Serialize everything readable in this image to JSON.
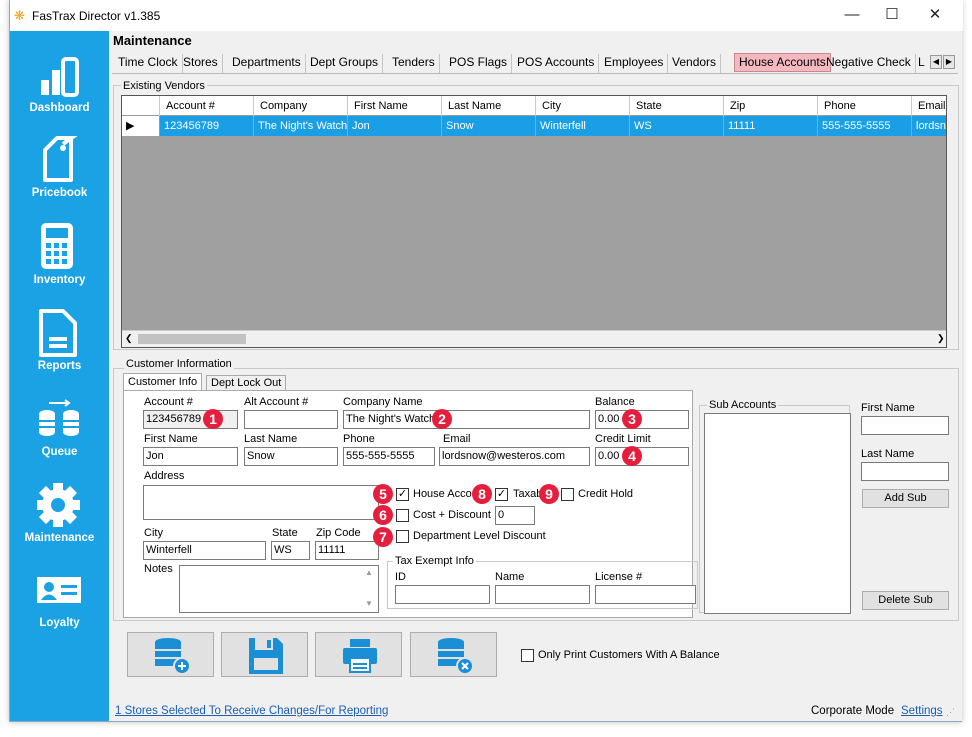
{
  "window": {
    "title": "FasTrax Director v1.385",
    "minimize": "—",
    "maximize": "☐",
    "close": "✕"
  },
  "sidebar": {
    "items": [
      {
        "id": "dashboard",
        "label": "Dashboard",
        "icon": "bar-chart-icon"
      },
      {
        "id": "pricebook",
        "label": "Pricebook",
        "icon": "tag-icon"
      },
      {
        "id": "inventory",
        "label": "Inventory",
        "icon": "calculator-icon"
      },
      {
        "id": "reports",
        "label": "Reports",
        "icon": "document-icon"
      },
      {
        "id": "queue",
        "label": "Queue",
        "icon": "database-sync-icon"
      },
      {
        "id": "maintenance",
        "label": "Maintenance",
        "icon": "gear-icon"
      },
      {
        "id": "loyalty",
        "label": "Loyalty",
        "icon": "id-card-icon"
      }
    ]
  },
  "header": {
    "title": "Maintenance"
  },
  "tabs": [
    "Time Clock",
    "Stores",
    "Departments",
    "Dept Groups",
    "Tenders",
    "POS Flags",
    "POS Accounts",
    "Employees",
    "Vendors",
    "House Accounts",
    "Negative Check",
    "L"
  ],
  "active_tab": "House Accounts",
  "existing": {
    "label": "Existing Vendors",
    "columns": [
      "Account #",
      "Company",
      "First Name",
      "Last Name",
      "City",
      "State",
      "Zip",
      "Phone",
      "Email"
    ],
    "rows": [
      {
        "indicator": "▶",
        "cells": [
          "123456789",
          "The Night's Watch",
          "Jon",
          "Snow",
          "Winterfell",
          "WS",
          "11111",
          "555-555-5555",
          "lordsnow"
        ]
      }
    ]
  },
  "customer": {
    "group_label": "Customer Information",
    "tabs": [
      "Customer Info",
      "Dept Lock Out"
    ],
    "fields": {
      "account_label": "Account #",
      "account": "123456789",
      "alt_label": "Alt Account #",
      "alt": "",
      "company_label": "Company Name",
      "company": "The Night's Watch",
      "balance_label": "Balance",
      "balance": "0.00",
      "first_label": "First Name",
      "first": "Jon",
      "last_label": "Last Name",
      "last": "Snow",
      "phone_label": "Phone",
      "phone": "555-555-5555",
      "email_label": "Email",
      "email": "lordsnow@westeros.com",
      "credit_label": "Credit Limit",
      "credit": "0.00",
      "address_label": "Address",
      "address": "",
      "city_label": "City",
      "city": "Winterfell",
      "state_label": "State",
      "state": "WS",
      "zip_label": "Zip Code",
      "zip": "11111",
      "notes_label": "Notes",
      "notes": ""
    },
    "checkboxes": {
      "house_account": "House Account",
      "taxable": "Taxable",
      "credit_hold": "Credit Hold",
      "cost_discount": "Cost + Discount",
      "cost_discount_value": "0",
      "dept_level_discount": "Department Level Discount"
    },
    "checked": {
      "house_account": true,
      "taxable": true,
      "credit_hold": false,
      "cost_discount": false,
      "dept_level_discount": false
    },
    "tax_exempt": {
      "label": "Tax Exempt Info",
      "id_label": "ID",
      "name_label": "Name",
      "license_label": "License #"
    },
    "sub_accounts": {
      "label": "Sub Accounts",
      "first_label": "First Name",
      "last_label": "Last Name",
      "add": "Add Sub",
      "delete": "Delete Sub"
    },
    "badges": [
      "1",
      "2",
      "3",
      "4",
      "5",
      "6",
      "7",
      "8",
      "9"
    ]
  },
  "actions": {
    "add_icon": "add-customer-icon",
    "save_icon": "save-icon",
    "print_icon": "print-icon",
    "delete_icon": "delete-customer-icon",
    "only_print_label": "Only Print Customers With A  Balance"
  },
  "status": {
    "stores_link": "1 Stores Selected To Receive Changes/For Reporting",
    "mode": "Corporate Mode",
    "settings": "Settings"
  },
  "colors": {
    "sidebar": "#1aa2e4",
    "selection": "#1a9ee6",
    "active_tab": "#f4b8c0",
    "badge": "#e61e3d",
    "link": "#1a5fb4",
    "icon_blue": "#1a8fd6"
  }
}
